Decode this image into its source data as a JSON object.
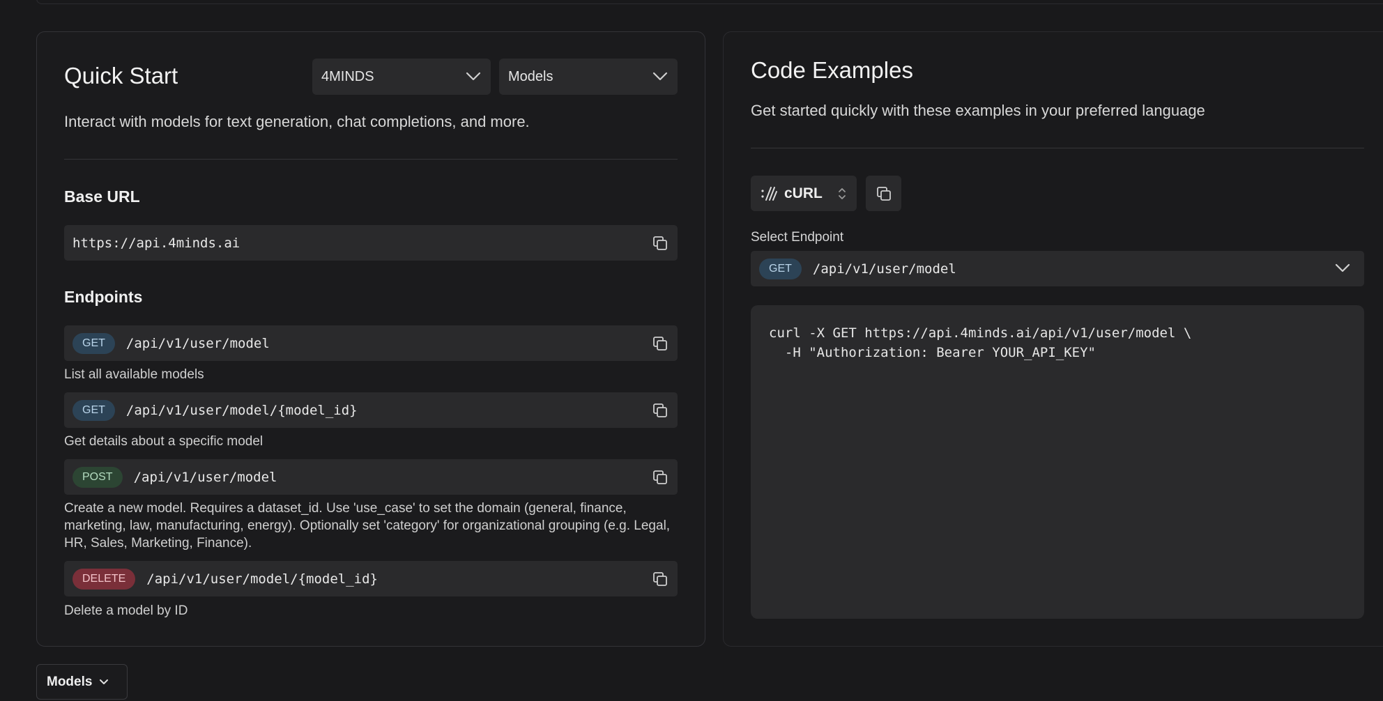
{
  "quick_start": {
    "title": "Quick Start",
    "org_dropdown": "4MINDS",
    "category_dropdown": "Models",
    "description": "Interact with models for text generation, chat completions, and more.",
    "base_url_heading": "Base URL",
    "base_url": "https://api.4minds.ai",
    "endpoints_heading": "Endpoints",
    "endpoints": [
      {
        "method": "GET",
        "path": "/api/v1/user/model",
        "description": "List all available models"
      },
      {
        "method": "GET",
        "path": "/api/v1/user/model/{model_id}",
        "description": "Get details about a specific model"
      },
      {
        "method": "POST",
        "path": "/api/v1/user/model",
        "description": "Create a new model. Requires a dataset_id. Use 'use_case' to set the domain (general, finance, marketing, law, manufacturing, energy). Optionally set 'category' for organizational grouping (e.g. Legal, HR, Sales, Marketing, Finance)."
      },
      {
        "method": "DELETE",
        "path": "/api/v1/user/model/{model_id}",
        "description": "Delete a model by ID"
      }
    ]
  },
  "code_examples": {
    "title": "Code Examples",
    "description": "Get started quickly with these examples in your preferred language",
    "language": "cURL",
    "select_endpoint_label": "Select Endpoint",
    "selected_method": "GET",
    "selected_path": "/api/v1/user/model",
    "code": "curl -X GET https://api.4minds.ai/api/v1/user/model \\\n  -H \"Authorization: Bearer YOUR_API_KEY\""
  },
  "bottom_selector": {
    "label": "Models"
  },
  "icons": {
    "copy": "copy-icon",
    "chevron": "chevron-down-icon",
    "curl": "curl-icon",
    "updown": "chevron-up-down-icon"
  },
  "colors": {
    "get_badge": "#2c4356",
    "post_badge": "#2c4533",
    "delete_badge": "#7a2f39"
  }
}
